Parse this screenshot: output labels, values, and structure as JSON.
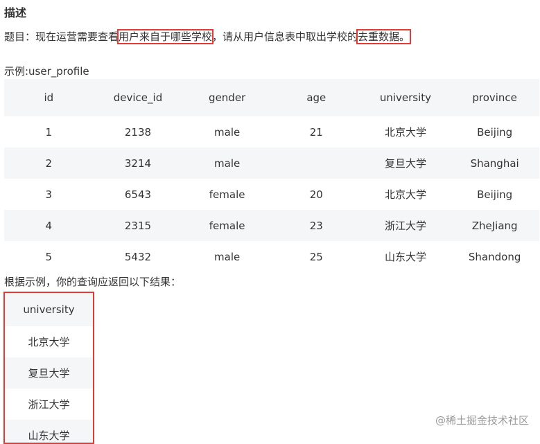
{
  "heading": "描述",
  "question": {
    "prefix": "题目：现在运营需要查看",
    "highlight1": "用户来自于哪些学校",
    "middle": "，请从用户信息表中取出学校的",
    "highlight2": "去重数据。"
  },
  "example_label": "示例:user_profile",
  "example_table": {
    "columns": [
      "id",
      "device_id",
      "gender",
      "age",
      "university",
      "province"
    ],
    "rows": [
      [
        "1",
        "2138",
        "male",
        "21",
        "北京大学",
        "Beijing"
      ],
      [
        "2",
        "3214",
        "male",
        "",
        "复旦大学",
        "Shanghai"
      ],
      [
        "3",
        "6543",
        "female",
        "20",
        "北京大学",
        "Beijing"
      ],
      [
        "4",
        "2315",
        "female",
        "23",
        "浙江大学",
        "ZheJiang"
      ],
      [
        "5",
        "5432",
        "male",
        "25",
        "山东大学",
        "Shandong"
      ]
    ]
  },
  "result_label": "根据示例，你的查询应返回以下结果：",
  "result_table": {
    "column": "university",
    "rows": [
      "北京大学",
      "复旦大学",
      "浙江大学",
      "山东大学"
    ]
  },
  "watermark": "@稀土掘金技术社区"
}
